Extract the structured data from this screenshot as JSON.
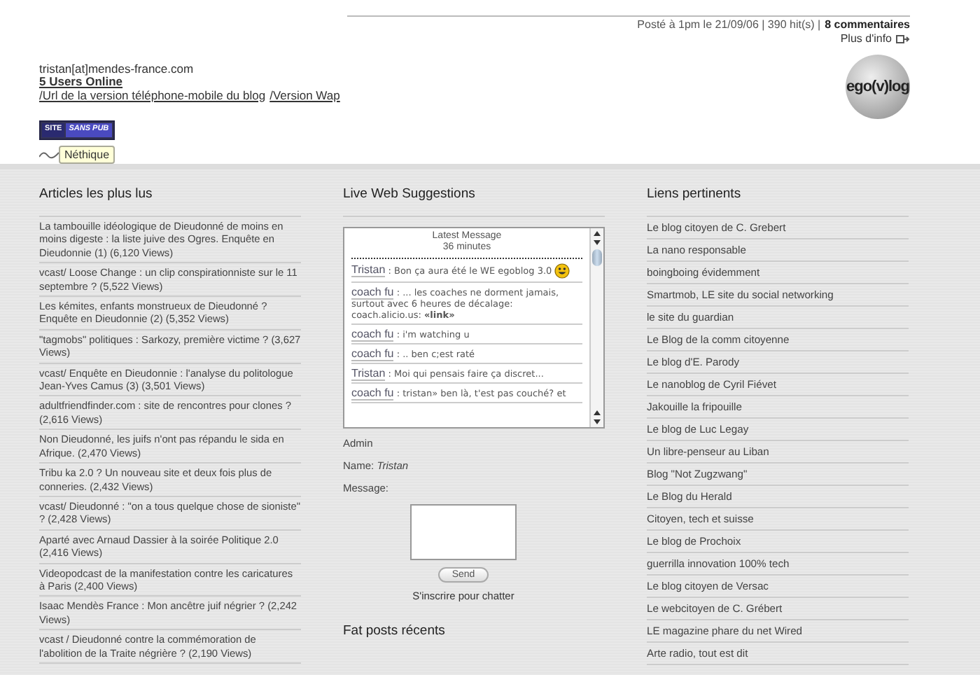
{
  "post_meta": {
    "text": "Posté à 1pm le 21/09/06 | 390 hit(s) |",
    "comments_link": "8 commentaires",
    "more_info": "Plus d'info"
  },
  "site_info": {
    "email": "tristan[at]mendes-france.com",
    "users_online": "5 Users Online",
    "mobile_link": "/Url de la version téléphone-mobile du blog",
    "wap_link": "/Version Wap"
  },
  "badges": {
    "site_badge": [
      "SITE",
      "SANS PUB"
    ],
    "nethique": "Néthique"
  },
  "logo": "ego(v)log",
  "most_read": {
    "title": "Articles les plus lus",
    "items": [
      "La tambouille idéologique de Dieudonné de moins en moins digeste : la liste juive des Ogres. Enquête en Dieudonnie (1) (6,120 Views)",
      "vcast/ Loose Change : un clip conspirationniste sur le 11 septembre ? (5,522 Views)",
      "Les kémites, enfants monstrueux de Dieudonné ? Enquête en Dieudonnie (2) (5,352 Views)",
      "\"tagmobs\" politiques : Sarkozy, première victime ? (3,627 Views)",
      "vcast/ Enquête en Dieudonnie : l'analyse du politologue Jean-Yves Camus (3) (3,501 Views)",
      "adultfriendfinder.com : site de rencontres pour clones ? (2,616 Views)",
      "Non Dieudonné, les juifs n'ont pas répandu le sida en Afrique. (2,470 Views)",
      "Tribu ka 2.0 ? Un nouveau site et deux fois plus de conneries. (2,432 Views)",
      "vcast/ Dieudonné : \"on a tous quelque chose de sioniste\" ? (2,428 Views)",
      "Aparté avec Arnaud Dassier à la soirée Politique 2.0 (2,416 Views)",
      "Videopodcast de la manifestation contre les caricatures à Paris (2,400 Views)",
      "Isaac Mendès France : Mon ancêtre juif négrier ? (2,242 Views)",
      "vcast / Dieudonné contre la commémoration de l'abolition de la Traite négrière ? (2,190 Views)"
    ]
  },
  "live_web": {
    "title": "Live Web Suggestions",
    "chat_header": "Latest Message",
    "chat_age": "36 minutes",
    "messages": [
      {
        "name": "Tristan",
        "separator": ":",
        "text": "Bon ça aura été le WE egoblog 3.0",
        "smiley": true
      },
      {
        "name": "coach fu",
        "separator": ":",
        "text": "... les coaches ne dorment jamais, surtout avec 6 heures de décalage: coach.alicio.us: **«link»**",
        "smiley": false
      },
      {
        "name": "coach fu",
        "separator": ":",
        "text": "i'm watching u",
        "smiley": false
      },
      {
        "name": "coach fu",
        "separator": ":",
        "text": ".. ben c;est raté",
        "smiley": false
      },
      {
        "name": "Tristan",
        "separator": ":",
        "text": "Moi qui pensais faire ça discret...",
        "smiley": false
      },
      {
        "name": "coach fu",
        "separator": ":",
        "text": "tristan» ben là, t'est pas couché? et",
        "smiley": false
      }
    ],
    "admin_label": "Admin",
    "name_label": "Name:",
    "name_value": "Tristan",
    "message_label": "Message:",
    "send_button": "Send",
    "signup_link": "S'inscrire pour chatter"
  },
  "recent_posts": {
    "title": "Fat posts récents"
  },
  "links": {
    "title": "Liens pertinents",
    "items": [
      "Le blog citoyen de C. Grebert",
      "La nano responsable",
      "boingboing évidemment",
      "Smartmob, LE site du social networking",
      "le site du guardian",
      "Le Blog de la comm citoyenne",
      "Le blog d'E. Parody",
      "Le nanoblog de Cyril Fiévet",
      "Jakouille la fripouille",
      "Le blog de Luc Legay",
      "Un libre-penseur au Liban",
      "Blog \"Not Zugzwang\"",
      "Le Blog du Herald",
      "Citoyen, tech et suisse",
      "Le blog de Prochoix",
      "guerrilla innovation 100% tech",
      "Le blog citoyen de Versac",
      "Le webcitoyen de C. Grébert",
      "LE magazine phare du net Wired",
      "Arte radio, tout est dit"
    ]
  }
}
